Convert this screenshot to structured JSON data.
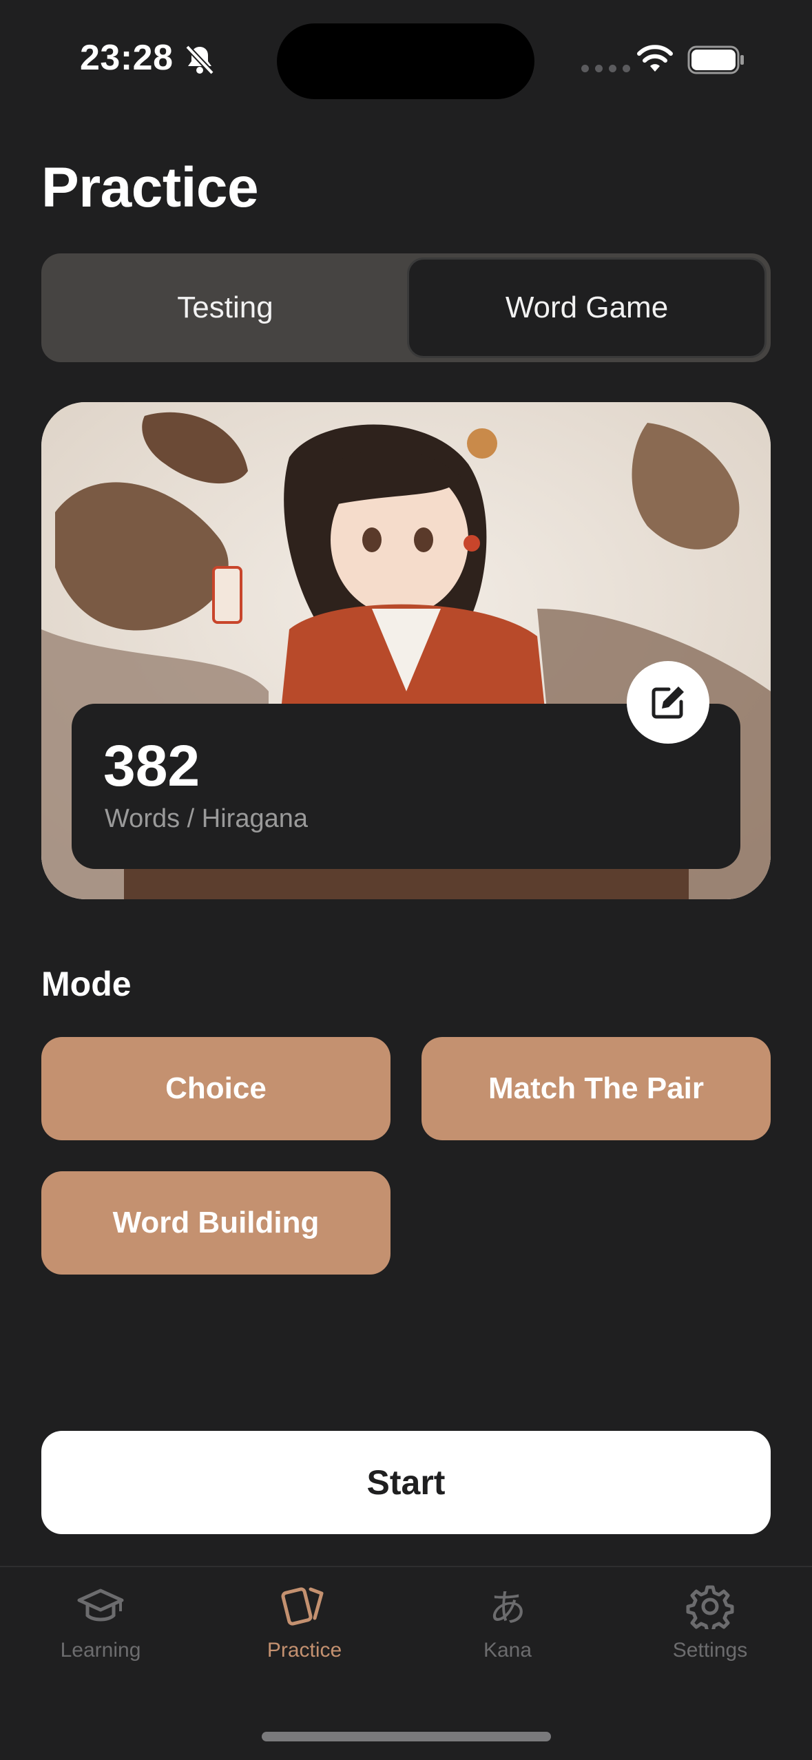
{
  "status_bar": {
    "time": "23:28",
    "icons": [
      "bell-off-icon",
      "signal-dots-icon",
      "wifi-icon",
      "battery-icon"
    ]
  },
  "page": {
    "title": "Practice"
  },
  "segmented_control": {
    "options": [
      "Testing",
      "Word Game"
    ],
    "selected": "Word Game"
  },
  "hero": {
    "image_subject": "anime girl with dragons illustration",
    "count": "382",
    "subtitle": "Words / Hiragana",
    "edit_icon": "edit-icon"
  },
  "mode": {
    "label": "Mode",
    "options": [
      "Choice",
      "Match The Pair",
      "Word Building"
    ]
  },
  "start": {
    "label": "Start"
  },
  "tabbar": {
    "items": [
      {
        "label": "Learning",
        "icon": "graduation-cap-icon"
      },
      {
        "label": "Practice",
        "icon": "cards-icon"
      },
      {
        "label": "Kana",
        "icon": "kana-a-icon"
      },
      {
        "label": "Settings",
        "icon": "gear-icon"
      }
    ],
    "active": "Practice"
  },
  "colors": {
    "background": "#1f1f20",
    "accent": "#c49170",
    "segment_track": "#464442",
    "inactive_tab": "#6c6c6e"
  }
}
